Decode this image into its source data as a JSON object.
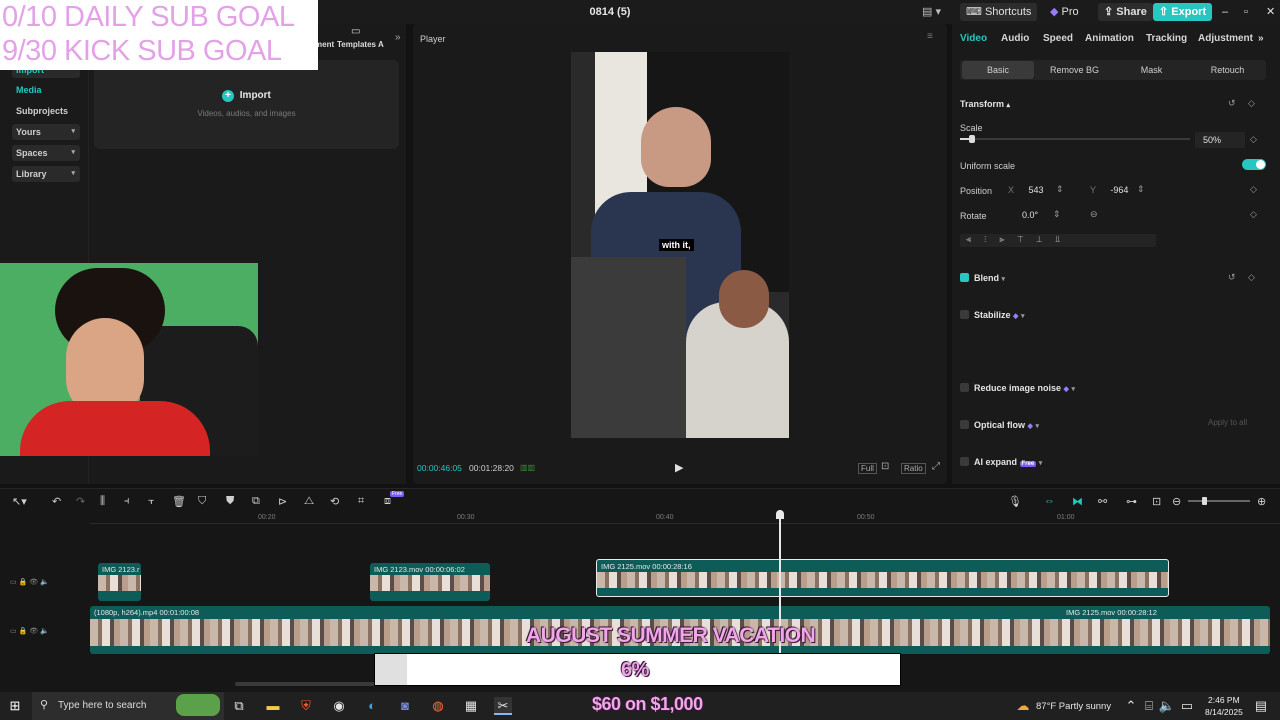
{
  "titlebar": {
    "project_title": "0814 (5)",
    "shortcuts_label": "Shortcuts",
    "pro_label": "Pro",
    "share_label": "Share",
    "export_label": "Export"
  },
  "left_nav": {
    "top_tabs": [
      "ment",
      "Templates",
      "A"
    ],
    "items": [
      {
        "label": "Import"
      },
      {
        "label": "Media"
      },
      {
        "label": "Subprojects"
      },
      {
        "label": "Yours"
      },
      {
        "label": "Spaces"
      },
      {
        "label": "Library"
      }
    ],
    "import_button": "Import",
    "import_hint": "Videos, audios, and images"
  },
  "player": {
    "label": "Player",
    "current_time": "00:00:46:05",
    "total_time": "00:01:28:20",
    "caption": "with it,",
    "controls": [
      "Full",
      "Ratio"
    ]
  },
  "right_panel": {
    "tabs": [
      "Video",
      "Audio",
      "Speed",
      "Animation",
      "Tracking",
      "Adjustment"
    ],
    "subtabs": [
      "Basic",
      "Remove BG",
      "Mask",
      "Retouch"
    ],
    "transform_label": "Transform",
    "scale_label": "Scale",
    "scale_value": "50%",
    "scale_fraction": 0.05,
    "uniform_scale_label": "Uniform scale",
    "position_label": "Position",
    "pos_x_label": "X",
    "pos_x": "543",
    "pos_y_label": "Y",
    "pos_y": "-964",
    "rotate_label": "Rotate",
    "rotate_value": "0.0°",
    "blend_label": "Blend",
    "stabilize_label": "Stabilize",
    "reduce_noise_label": "Reduce image noise",
    "optical_flow_label": "Optical flow",
    "apply_all_label": "Apply to all",
    "ai_expand_label": "AI expand",
    "ai_expand_badge": "Free"
  },
  "timeline": {
    "ruler": [
      "00:20",
      "00:30",
      "00:40",
      "00:50",
      "01:00"
    ],
    "tool_badge": "Free",
    "clips_top": [
      {
        "name": "IMG 2123.r"
      },
      {
        "name": "IMG 2123.mov  00:00:06:02"
      },
      {
        "name": "IMG 2125.mov  00:00:28:16"
      }
    ],
    "main_clip": "(1080p, h264).mp4  00:01:00:08",
    "main_clip_end": "IMG 2125.mov  00:00:28:12"
  },
  "overlays": {
    "daily_goal": "0/10 DAILY SUB GOAL",
    "kick_goal": "9/30 KICK SUB GOAL",
    "vacation_title": "AUGUST SUMMER VACATION",
    "progress_percent": "6%",
    "progress_fraction": 0.06,
    "money": "$60 on $1,000"
  },
  "taskbar": {
    "search_placeholder": "Type here to search",
    "weather": "87°F  Partly sunny",
    "time": "2:46 PM",
    "date": "8/14/2025"
  },
  "colors": {
    "accent": "#27c6c1",
    "overlay_pink": "#f2a6ea",
    "clip_teal": "#0d5c58"
  }
}
